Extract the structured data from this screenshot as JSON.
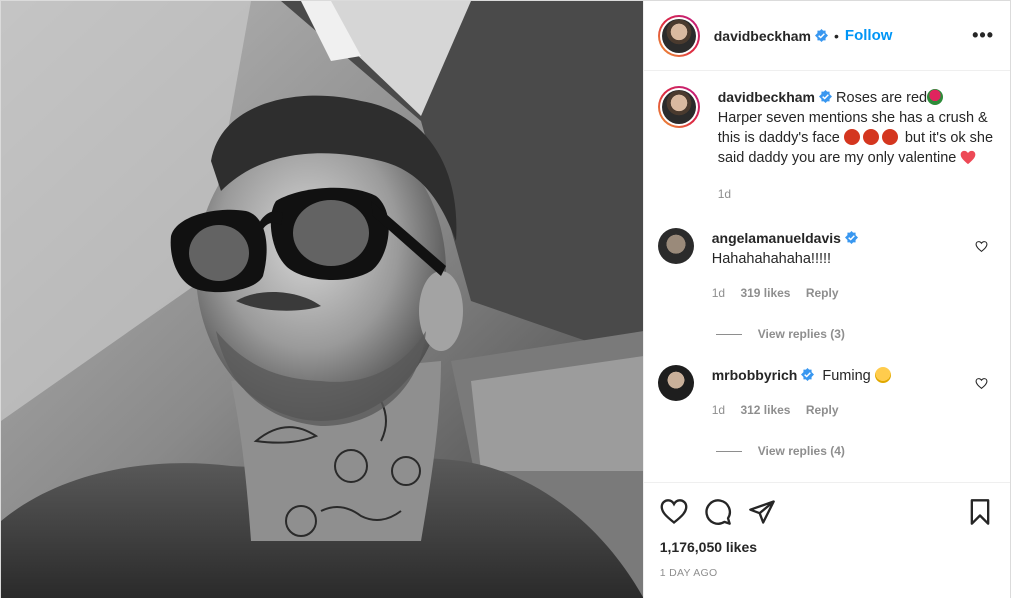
{
  "post": {
    "author": "davidbeckham",
    "follow_label": "Follow",
    "dot": "•",
    "more_label": "•••",
    "caption": {
      "username": "davidbeckham",
      "text_1": "Roses are red",
      "text_2": "Harper seven mentions she has a crush & this is daddy's face",
      "text_3": "but it's ok she said daddy you are my only valentine",
      "time": "1d"
    },
    "comments": [
      {
        "username": "angelamanueldavis",
        "text": "Hahahahahaha!!!!!",
        "time": "1d",
        "likes": "319 likes",
        "reply": "Reply",
        "view_replies": "View replies (3)"
      },
      {
        "username": "mrbobbyrich",
        "text": "Fuming",
        "time": "1d",
        "likes": "312 likes",
        "reply": "Reply",
        "view_replies": "View replies (4)"
      }
    ],
    "likes": "1,176,050 likes",
    "date": "1 DAY AGO"
  },
  "colors": {
    "follow": "#0095f6",
    "muted": "#8e8e8e",
    "verified": "#3897f0",
    "heart": "#ed4956"
  },
  "icons": [
    "verified-badge-icon",
    "more-icon",
    "heart-icon",
    "comment-icon",
    "share-icon",
    "bookmark-icon",
    "rose-emoji",
    "angry-emoji",
    "red-heart-emoji",
    "laughing-emoji"
  ]
}
